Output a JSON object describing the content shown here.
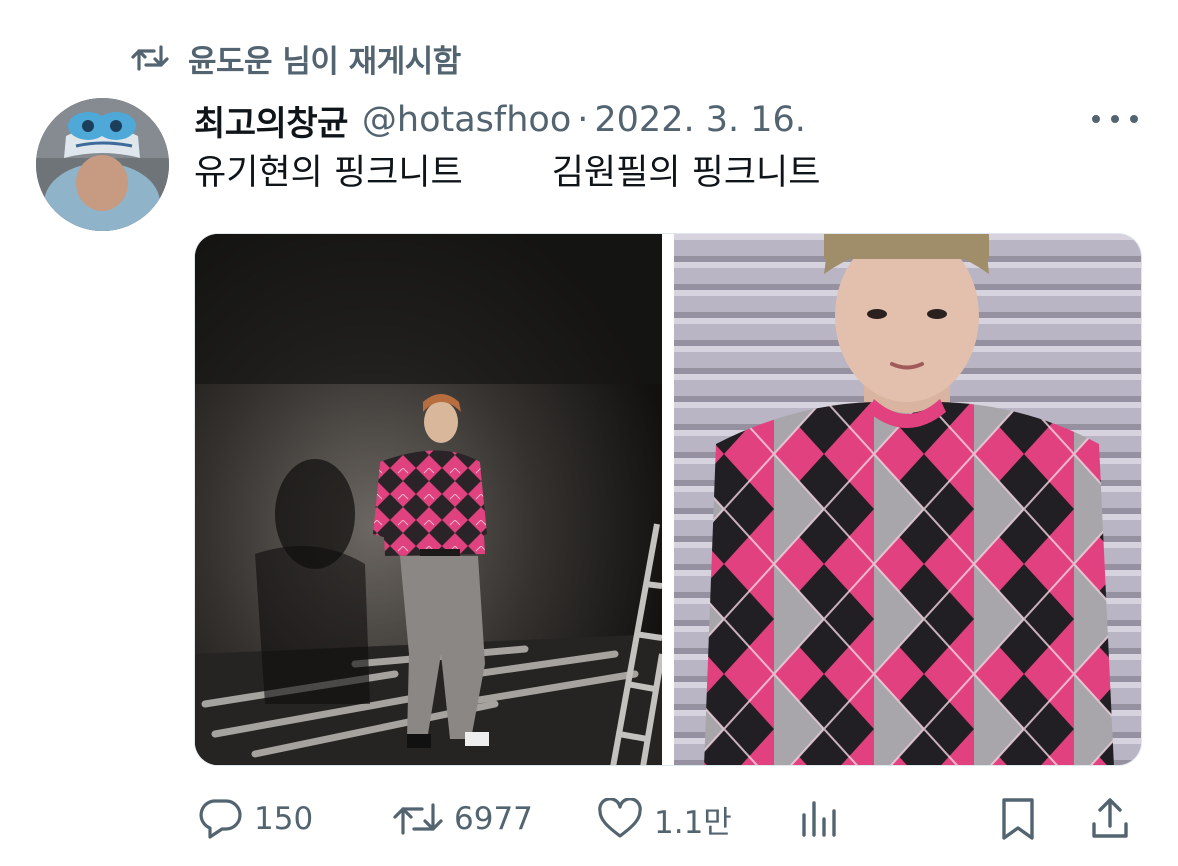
{
  "repost": {
    "label": "윤도운 님이 재게시함",
    "icon": "repost-icon"
  },
  "tweet": {
    "display_name": "최고의창균",
    "handle": "@hotasfhoo",
    "separator": "·",
    "date": "2022. 3. 16.",
    "text": "유기현의 핑크니트        김원필의 핑크니트",
    "media": [
      {
        "name": "photo-left",
        "subject": "person in pink argyle sweater and grey trousers against dark backdrop"
      },
      {
        "name": "photo-right",
        "subject": "person in pink argyle sweater against lavender shutter wall"
      }
    ]
  },
  "actions": {
    "reply": {
      "icon": "reply-icon",
      "count": "150"
    },
    "repost": {
      "icon": "repost-icon",
      "count": "6977"
    },
    "like": {
      "icon": "heart-icon",
      "count": "1.1만"
    },
    "views": {
      "icon": "views-icon"
    },
    "bookmark": {
      "icon": "bookmark-icon"
    },
    "share": {
      "icon": "share-icon"
    }
  },
  "colors": {
    "text_primary": "#0f1419",
    "text_secondary": "#536471",
    "sweater_pink": "#e0417f",
    "argyle_dark": "#1f1d21",
    "argyle_grey": "#a9a6ab"
  }
}
